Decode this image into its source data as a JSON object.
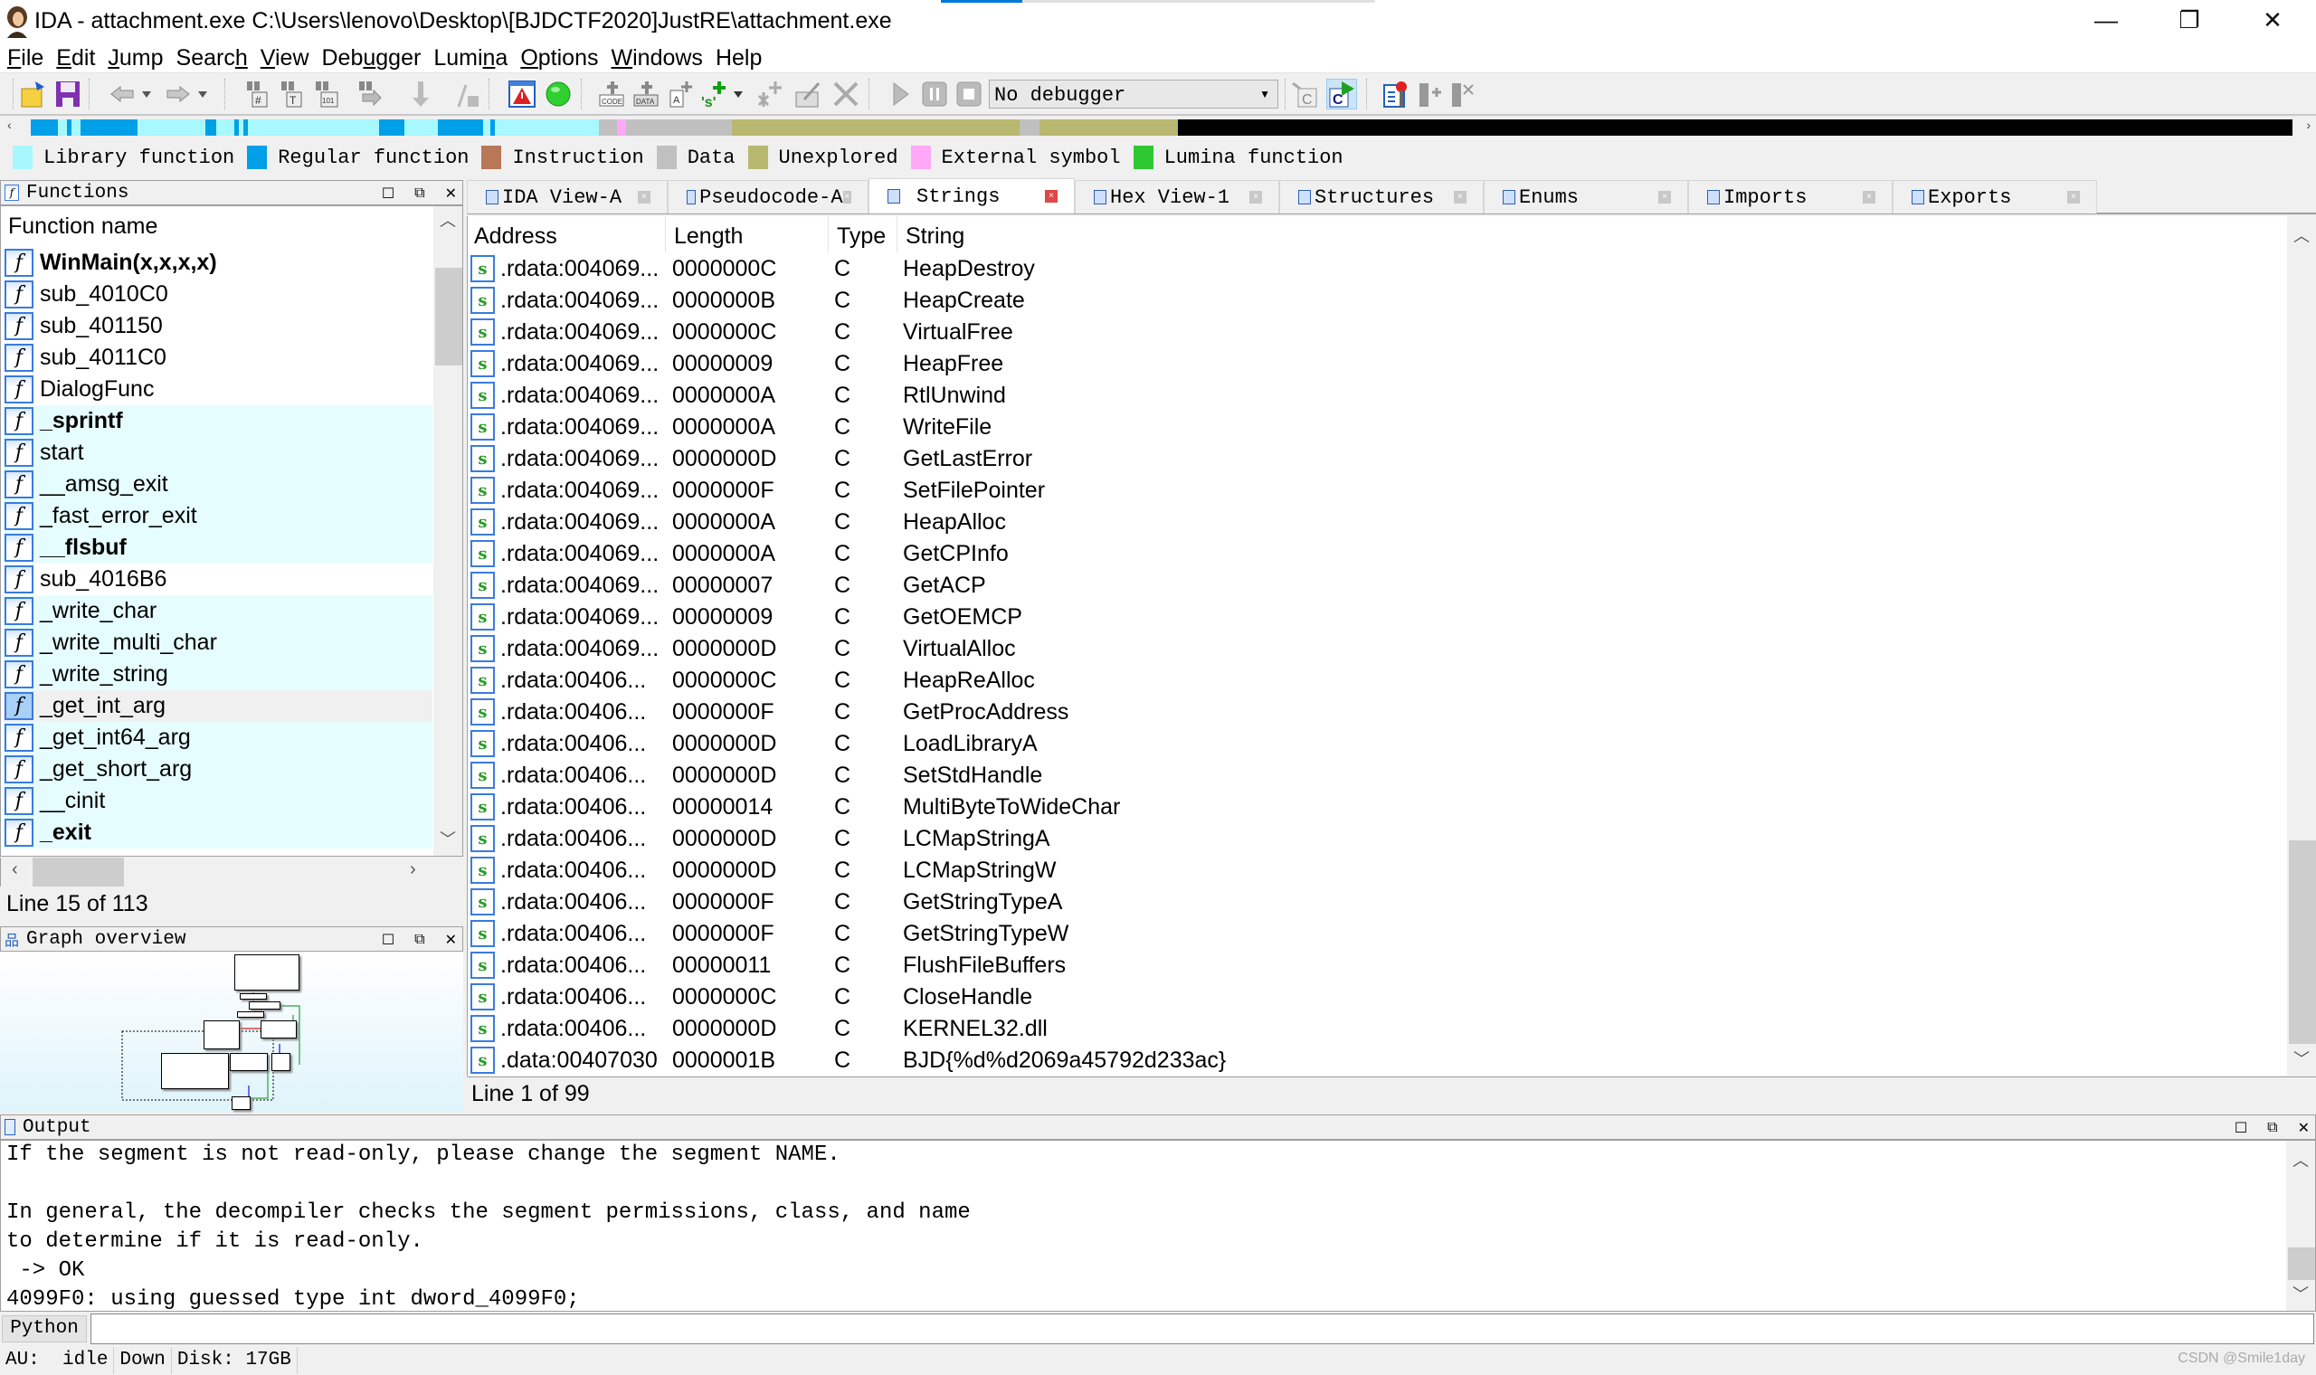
{
  "window": {
    "title": "IDA - attachment.exe C:\\Users\\lenovo\\Desktop\\[BJDCTF2020]JustRE\\attachment.exe",
    "controls": {
      "minimize": "—",
      "restore": "❐",
      "close": "✕"
    }
  },
  "menu": [
    {
      "label": "File",
      "accel": "F",
      "rest": "ile"
    },
    {
      "label": "Edit",
      "accel": "E",
      "rest": "dit"
    },
    {
      "label": "Jump",
      "accel": "J",
      "rest": "ump"
    },
    {
      "label": "Search",
      "pre": "Searc",
      "accel": "h",
      "rest": ""
    },
    {
      "label": "View",
      "accel": "V",
      "rest": "iew"
    },
    {
      "label": "Debugger",
      "pre": "Deb",
      "accel": "u",
      "rest": "gger"
    },
    {
      "label": "Lumina",
      "pre": "Lumi",
      "accel": "n",
      "rest": "a"
    },
    {
      "label": "Options",
      "accel": "O",
      "rest": "ptions"
    },
    {
      "label": "Windows",
      "accel": "W",
      "rest": "indows"
    },
    {
      "label": "Help",
      "accel": "",
      "rest": "Help"
    }
  ],
  "toolbar": {
    "icons": [
      "open-file-icon",
      "save-icon",
      "back-icon",
      "back-dropdown-icon",
      "forward-icon",
      "forward-dropdown-icon",
      "search-sequence-icon",
      "search-text-icon",
      "search-immediate-icon",
      "search-next-icon",
      "jump-down-icon",
      "lock-icon",
      "warning-icon",
      "green-circle-icon",
      "make-code-icon",
      "make-data-icon",
      "make-ascii-icon",
      "make-string-icon",
      "string-dropdown-icon",
      "create-struct-icon",
      "edit-icon",
      "delete-icon",
      "start-debugger-icon",
      "pause-debugger-icon",
      "stop-debugger-icon",
      "debugger-select",
      "c-source-icon",
      "c-run-icon",
      "breakpoint-list-icon",
      "add-breakpoint-icon",
      "delete-breakpoint-icon"
    ],
    "debugger_value": "No debugger"
  },
  "navbar": {
    "segments": [
      {
        "type": "regular",
        "from": 0.0,
        "to": 0.012
      },
      {
        "type": "library",
        "from": 0.012,
        "to": 0.016
      },
      {
        "type": "regular",
        "from": 0.016,
        "to": 0.018
      },
      {
        "type": "library",
        "from": 0.018,
        "to": 0.022
      },
      {
        "type": "regular",
        "from": 0.022,
        "to": 0.047
      },
      {
        "type": "library",
        "from": 0.047,
        "to": 0.077
      },
      {
        "type": "regular",
        "from": 0.077,
        "to": 0.082
      },
      {
        "type": "library",
        "from": 0.082,
        "to": 0.09
      },
      {
        "type": "regular",
        "from": 0.09,
        "to": 0.092
      },
      {
        "type": "library",
        "from": 0.092,
        "to": 0.094
      },
      {
        "type": "regular",
        "from": 0.094,
        "to": 0.096
      },
      {
        "type": "library",
        "from": 0.096,
        "to": 0.154
      },
      {
        "type": "regular",
        "from": 0.154,
        "to": 0.165
      },
      {
        "type": "library",
        "from": 0.165,
        "to": 0.18
      },
      {
        "type": "regular",
        "from": 0.18,
        "to": 0.2
      },
      {
        "type": "library",
        "from": 0.2,
        "to": 0.203
      },
      {
        "type": "regular",
        "from": 0.203,
        "to": 0.205
      },
      {
        "type": "library",
        "from": 0.205,
        "to": 0.251
      },
      {
        "type": "data",
        "from": 0.251,
        "to": 0.259
      },
      {
        "type": "external",
        "from": 0.259,
        "to": 0.263
      },
      {
        "type": "data",
        "from": 0.263,
        "to": 0.31
      },
      {
        "type": "unexplored",
        "from": 0.31,
        "to": 0.437
      },
      {
        "type": "data",
        "from": 0.437,
        "to": 0.446
      },
      {
        "type": "unexplored",
        "from": 0.446,
        "to": 0.507
      }
    ]
  },
  "legend": [
    {
      "label": "Library function",
      "color": "#a8f8ff"
    },
    {
      "label": "Regular function",
      "color": "#00a0e8"
    },
    {
      "label": "Instruction",
      "color": "#b87858"
    },
    {
      "label": "Data",
      "color": "#c0c0c0"
    },
    {
      "label": "Unexplored",
      "color": "#b8b870"
    },
    {
      "label": "External symbol",
      "color": "#ffa8f8"
    },
    {
      "label": "Lumina function",
      "color": "#30c830"
    }
  ],
  "functions": {
    "title": "Functions",
    "column": "Function name",
    "status": "Line 15 of 113",
    "rows": [
      {
        "name": "WinMain(x,x,x,x)",
        "bold": true,
        "lib": false
      },
      {
        "name": "sub_4010C0",
        "bold": false,
        "lib": false
      },
      {
        "name": "sub_401150",
        "bold": false,
        "lib": false
      },
      {
        "name": "sub_4011C0",
        "bold": false,
        "lib": false
      },
      {
        "name": "DialogFunc",
        "bold": false,
        "lib": false
      },
      {
        "name": "_sprintf",
        "bold": true,
        "lib": true
      },
      {
        "name": "start",
        "bold": false,
        "lib": true
      },
      {
        "name": "__amsg_exit",
        "bold": false,
        "lib": true
      },
      {
        "name": "_fast_error_exit",
        "bold": false,
        "lib": true
      },
      {
        "name": "__flsbuf",
        "bold": true,
        "lib": true
      },
      {
        "name": "sub_4016B6",
        "bold": false,
        "lib": false
      },
      {
        "name": "_write_char",
        "bold": false,
        "lib": true
      },
      {
        "name": "_write_multi_char",
        "bold": false,
        "lib": true
      },
      {
        "name": "_write_string",
        "bold": false,
        "lib": true
      },
      {
        "name": "_get_int_arg",
        "bold": false,
        "lib": true,
        "selected": true
      },
      {
        "name": "_get_int64_arg",
        "bold": false,
        "lib": true
      },
      {
        "name": "_get_short_arg",
        "bold": false,
        "lib": true
      },
      {
        "name": "__cinit",
        "bold": false,
        "lib": true
      },
      {
        "name": "_exit",
        "bold": true,
        "lib": true
      }
    ]
  },
  "graph_overview": {
    "title": "Graph overview"
  },
  "tabs": [
    {
      "label": "IDA View-A",
      "active": false
    },
    {
      "label": "Pseudocode-A",
      "active": false
    },
    {
      "label": "Strings",
      "active": true
    },
    {
      "label": "Hex View-1",
      "active": false
    },
    {
      "label": "Structures",
      "active": false
    },
    {
      "label": "Enums",
      "active": false
    },
    {
      "label": "Imports",
      "active": false
    },
    {
      "label": "Exports",
      "active": false
    }
  ],
  "strings": {
    "columns": [
      "Address",
      "Length",
      "Type",
      "String"
    ],
    "status": "Line 1 of 99",
    "rows": [
      {
        "address": ".rdata:004069...",
        "length": "0000000C",
        "type": "C",
        "string": "HeapDestroy"
      },
      {
        "address": ".rdata:004069...",
        "length": "0000000B",
        "type": "C",
        "string": "HeapCreate"
      },
      {
        "address": ".rdata:004069...",
        "length": "0000000C",
        "type": "C",
        "string": "VirtualFree"
      },
      {
        "address": ".rdata:004069...",
        "length": "00000009",
        "type": "C",
        "string": "HeapFree"
      },
      {
        "address": ".rdata:004069...",
        "length": "0000000A",
        "type": "C",
        "string": "RtlUnwind"
      },
      {
        "address": ".rdata:004069...",
        "length": "0000000A",
        "type": "C",
        "string": "WriteFile"
      },
      {
        "address": ".rdata:004069...",
        "length": "0000000D",
        "type": "C",
        "string": "GetLastError"
      },
      {
        "address": ".rdata:004069...",
        "length": "0000000F",
        "type": "C",
        "string": "SetFilePointer"
      },
      {
        "address": ".rdata:004069...",
        "length": "0000000A",
        "type": "C",
        "string": "HeapAlloc"
      },
      {
        "address": ".rdata:004069...",
        "length": "0000000A",
        "type": "C",
        "string": "GetCPInfo"
      },
      {
        "address": ".rdata:004069...",
        "length": "00000007",
        "type": "C",
        "string": "GetACP"
      },
      {
        "address": ".rdata:004069...",
        "length": "00000009",
        "type": "C",
        "string": "GetOEMCP"
      },
      {
        "address": ".rdata:004069...",
        "length": "0000000D",
        "type": "C",
        "string": "VirtualAlloc"
      },
      {
        "address": ".rdata:00406...",
        "length": "0000000C",
        "type": "C",
        "string": "HeapReAlloc"
      },
      {
        "address": ".rdata:00406...",
        "length": "0000000F",
        "type": "C",
        "string": "GetProcAddress"
      },
      {
        "address": ".rdata:00406...",
        "length": "0000000D",
        "type": "C",
        "string": "LoadLibraryA"
      },
      {
        "address": ".rdata:00406...",
        "length": "0000000D",
        "type": "C",
        "string": "SetStdHandle"
      },
      {
        "address": ".rdata:00406...",
        "length": "00000014",
        "type": "C",
        "string": "MultiByteToWideChar"
      },
      {
        "address": ".rdata:00406...",
        "length": "0000000D",
        "type": "C",
        "string": "LCMapStringA"
      },
      {
        "address": ".rdata:00406...",
        "length": "0000000D",
        "type": "C",
        "string": "LCMapStringW"
      },
      {
        "address": ".rdata:00406...",
        "length": "0000000F",
        "type": "C",
        "string": "GetStringTypeA"
      },
      {
        "address": ".rdata:00406...",
        "length": "0000000F",
        "type": "C",
        "string": "GetStringTypeW"
      },
      {
        "address": ".rdata:00406...",
        "length": "00000011",
        "type": "C",
        "string": "FlushFileBuffers"
      },
      {
        "address": ".rdata:00406...",
        "length": "0000000C",
        "type": "C",
        "string": "CloseHandle"
      },
      {
        "address": ".rdata:00406...",
        "length": "0000000D",
        "type": "C",
        "string": "KERNEL32.dll"
      },
      {
        "address": ".data:00407030",
        "length": "0000001B",
        "type": "C",
        "string": " BJD{%d%d2069a45792d233ac}"
      }
    ]
  },
  "output": {
    "title": "Output",
    "lines": [
      "If the segment is not read-only, please change the segment NAME.",
      "",
      "In general, the decompiler checks the segment permissions, class, and name",
      "to determine if it is read-only.",
      " -> OK",
      "4099F0: using guessed type int dword_4099F0;"
    ]
  },
  "python": {
    "label": "Python",
    "value": ""
  },
  "status": {
    "au": "AU:  idle",
    "direction": "Down",
    "disk": "Disk: 17GB",
    "watermark": "CSDN @Smile1day"
  }
}
